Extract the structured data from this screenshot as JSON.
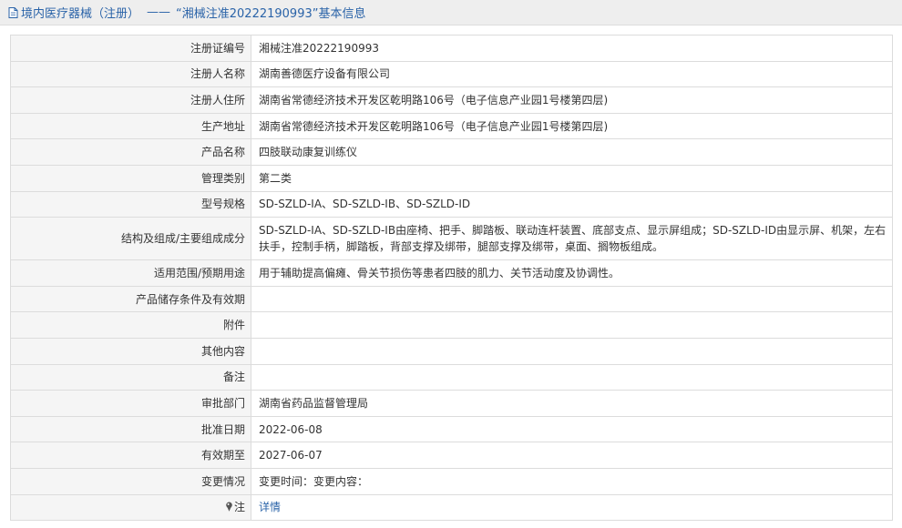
{
  "header": {
    "section": "境内医疗器械（注册）",
    "separator": "——",
    "title": "“湘械注准20222190993”基本信息"
  },
  "rows": [
    {
      "label": "注册证编号",
      "value": "湘械注准20222190993"
    },
    {
      "label": "注册人名称",
      "value": "湖南善德医疗设备有限公司"
    },
    {
      "label": "注册人住所",
      "value": "湖南省常德经济技术开发区乾明路106号（电子信息产业园1号楼第四层)"
    },
    {
      "label": "生产地址",
      "value": "湖南省常德经济技术开发区乾明路106号（电子信息产业园1号楼第四层)"
    },
    {
      "label": "产品名称",
      "value": "四肢联动康复训练仪"
    },
    {
      "label": "管理类别",
      "value": "第二类"
    },
    {
      "label": "型号规格",
      "value": "SD-SZLD-IA、SD-SZLD-IB、SD-SZLD-ID"
    },
    {
      "label": "结构及组成/主要组成成分",
      "value": "SD-SZLD-IA、SD-SZLD-IB由座椅、把手、脚踏板、联动连杆装置、底部支点、显示屏组成；SD-SZLD-ID由显示屏、机架，左右扶手，控制手柄，脚踏板，背部支撑及绑带，腿部支撑及绑带，桌面、搁物板组成。"
    },
    {
      "label": "适用范围/预期用途",
      "value": "用于辅助提高偏瘫、骨关节损伤等患者四肢的肌力、关节活动度及协调性。"
    },
    {
      "label": "产品储存条件及有效期",
      "value": ""
    },
    {
      "label": "附件",
      "value": ""
    },
    {
      "label": "其他内容",
      "value": ""
    },
    {
      "label": "备注",
      "value": ""
    },
    {
      "label": "审批部门",
      "value": "湖南省药品监督管理局"
    },
    {
      "label": "批准日期",
      "value": "2022-06-08"
    },
    {
      "label": "有效期至",
      "value": "2027-06-07"
    },
    {
      "label": "变更情况",
      "value": "变更时间：变更内容："
    }
  ],
  "note": {
    "label": "注",
    "link": "详情",
    "icon": "pin-icon"
  },
  "colors": {
    "link": "#2a63a8",
    "label_bg": "#f5f5f5",
    "border": "#dcdcdc",
    "header_bg": "#eeeeee"
  }
}
